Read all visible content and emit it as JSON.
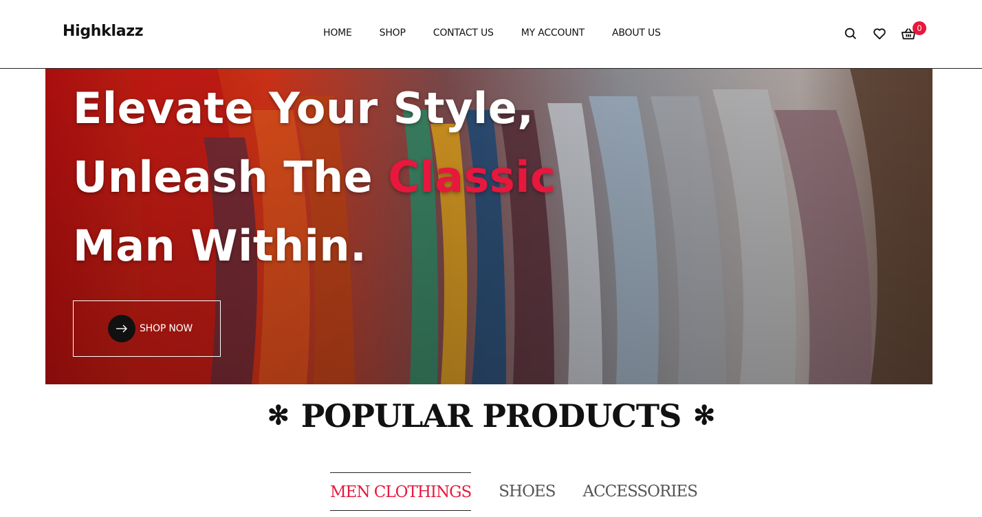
{
  "brand": {
    "logo": "Highklazz"
  },
  "nav": [
    {
      "label": "HOME"
    },
    {
      "label": "SHOP"
    },
    {
      "label": "CONTACT US"
    },
    {
      "label": "MY ACCOUNT"
    },
    {
      "label": "ABOUT US"
    }
  ],
  "header_icons": [
    "search-icon",
    "heart-icon",
    "basket-icon"
  ],
  "cart": {
    "count": "0"
  },
  "hero": {
    "line1": "Elevate Your Style,",
    "line2_prefix": "Unleash The ",
    "line2_accent": "Classic",
    "line3": "Man Within.",
    "cta_label": "SHOP NOW"
  },
  "popular": {
    "title": "POPULAR PRODUCTS",
    "star": "✻",
    "tabs": [
      {
        "label": "MEN CLOTHINGS",
        "active": true
      },
      {
        "label": "SHOES",
        "active": false
      },
      {
        "label": "ACCESSORIES",
        "active": false
      }
    ]
  },
  "colors": {
    "accent": "#e8173d",
    "text": "#111111"
  }
}
